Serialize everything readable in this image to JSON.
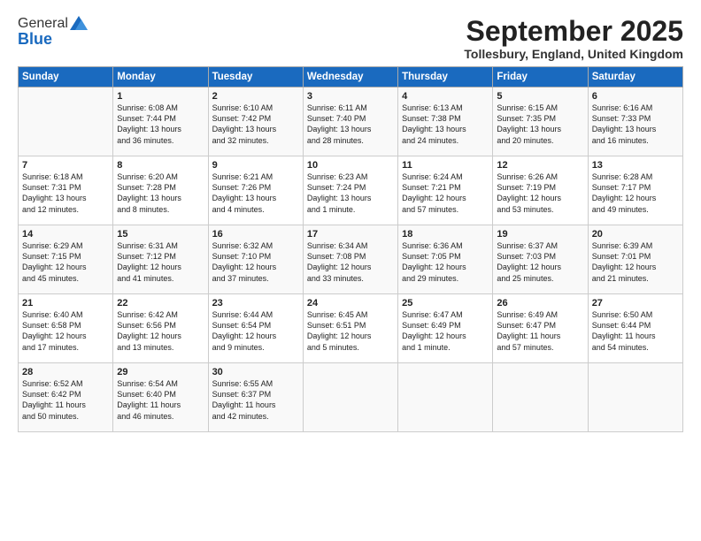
{
  "header": {
    "logo_general": "General",
    "logo_blue": "Blue",
    "month_title": "September 2025",
    "location": "Tollesbury, England, United Kingdom"
  },
  "days_of_week": [
    "Sunday",
    "Monday",
    "Tuesday",
    "Wednesday",
    "Thursday",
    "Friday",
    "Saturday"
  ],
  "weeks": [
    [
      {
        "day": "",
        "info": ""
      },
      {
        "day": "1",
        "info": "Sunrise: 6:08 AM\nSunset: 7:44 PM\nDaylight: 13 hours\nand 36 minutes."
      },
      {
        "day": "2",
        "info": "Sunrise: 6:10 AM\nSunset: 7:42 PM\nDaylight: 13 hours\nand 32 minutes."
      },
      {
        "day": "3",
        "info": "Sunrise: 6:11 AM\nSunset: 7:40 PM\nDaylight: 13 hours\nand 28 minutes."
      },
      {
        "day": "4",
        "info": "Sunrise: 6:13 AM\nSunset: 7:38 PM\nDaylight: 13 hours\nand 24 minutes."
      },
      {
        "day": "5",
        "info": "Sunrise: 6:15 AM\nSunset: 7:35 PM\nDaylight: 13 hours\nand 20 minutes."
      },
      {
        "day": "6",
        "info": "Sunrise: 6:16 AM\nSunset: 7:33 PM\nDaylight: 13 hours\nand 16 minutes."
      }
    ],
    [
      {
        "day": "7",
        "info": "Sunrise: 6:18 AM\nSunset: 7:31 PM\nDaylight: 13 hours\nand 12 minutes."
      },
      {
        "day": "8",
        "info": "Sunrise: 6:20 AM\nSunset: 7:28 PM\nDaylight: 13 hours\nand 8 minutes."
      },
      {
        "day": "9",
        "info": "Sunrise: 6:21 AM\nSunset: 7:26 PM\nDaylight: 13 hours\nand 4 minutes."
      },
      {
        "day": "10",
        "info": "Sunrise: 6:23 AM\nSunset: 7:24 PM\nDaylight: 13 hours\nand 1 minute."
      },
      {
        "day": "11",
        "info": "Sunrise: 6:24 AM\nSunset: 7:21 PM\nDaylight: 12 hours\nand 57 minutes."
      },
      {
        "day": "12",
        "info": "Sunrise: 6:26 AM\nSunset: 7:19 PM\nDaylight: 12 hours\nand 53 minutes."
      },
      {
        "day": "13",
        "info": "Sunrise: 6:28 AM\nSunset: 7:17 PM\nDaylight: 12 hours\nand 49 minutes."
      }
    ],
    [
      {
        "day": "14",
        "info": "Sunrise: 6:29 AM\nSunset: 7:15 PM\nDaylight: 12 hours\nand 45 minutes."
      },
      {
        "day": "15",
        "info": "Sunrise: 6:31 AM\nSunset: 7:12 PM\nDaylight: 12 hours\nand 41 minutes."
      },
      {
        "day": "16",
        "info": "Sunrise: 6:32 AM\nSunset: 7:10 PM\nDaylight: 12 hours\nand 37 minutes."
      },
      {
        "day": "17",
        "info": "Sunrise: 6:34 AM\nSunset: 7:08 PM\nDaylight: 12 hours\nand 33 minutes."
      },
      {
        "day": "18",
        "info": "Sunrise: 6:36 AM\nSunset: 7:05 PM\nDaylight: 12 hours\nand 29 minutes."
      },
      {
        "day": "19",
        "info": "Sunrise: 6:37 AM\nSunset: 7:03 PM\nDaylight: 12 hours\nand 25 minutes."
      },
      {
        "day": "20",
        "info": "Sunrise: 6:39 AM\nSunset: 7:01 PM\nDaylight: 12 hours\nand 21 minutes."
      }
    ],
    [
      {
        "day": "21",
        "info": "Sunrise: 6:40 AM\nSunset: 6:58 PM\nDaylight: 12 hours\nand 17 minutes."
      },
      {
        "day": "22",
        "info": "Sunrise: 6:42 AM\nSunset: 6:56 PM\nDaylight: 12 hours\nand 13 minutes."
      },
      {
        "day": "23",
        "info": "Sunrise: 6:44 AM\nSunset: 6:54 PM\nDaylight: 12 hours\nand 9 minutes."
      },
      {
        "day": "24",
        "info": "Sunrise: 6:45 AM\nSunset: 6:51 PM\nDaylight: 12 hours\nand 5 minutes."
      },
      {
        "day": "25",
        "info": "Sunrise: 6:47 AM\nSunset: 6:49 PM\nDaylight: 12 hours\nand 1 minute."
      },
      {
        "day": "26",
        "info": "Sunrise: 6:49 AM\nSunset: 6:47 PM\nDaylight: 11 hours\nand 57 minutes."
      },
      {
        "day": "27",
        "info": "Sunrise: 6:50 AM\nSunset: 6:44 PM\nDaylight: 11 hours\nand 54 minutes."
      }
    ],
    [
      {
        "day": "28",
        "info": "Sunrise: 6:52 AM\nSunset: 6:42 PM\nDaylight: 11 hours\nand 50 minutes."
      },
      {
        "day": "29",
        "info": "Sunrise: 6:54 AM\nSunset: 6:40 PM\nDaylight: 11 hours\nand 46 minutes."
      },
      {
        "day": "30",
        "info": "Sunrise: 6:55 AM\nSunset: 6:37 PM\nDaylight: 11 hours\nand 42 minutes."
      },
      {
        "day": "",
        "info": ""
      },
      {
        "day": "",
        "info": ""
      },
      {
        "day": "",
        "info": ""
      },
      {
        "day": "",
        "info": ""
      }
    ]
  ]
}
